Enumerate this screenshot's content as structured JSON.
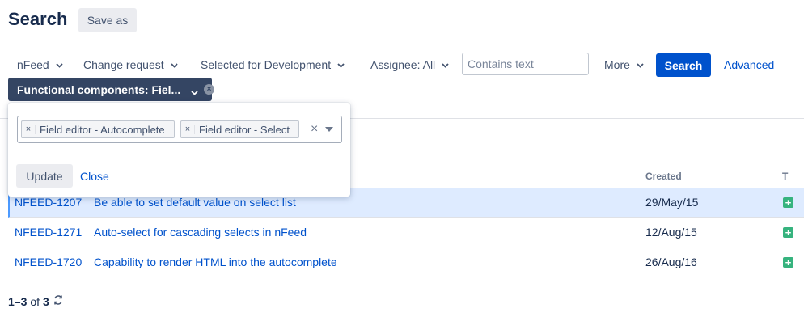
{
  "header": {
    "title": "Search",
    "save_as_label": "Save as"
  },
  "filters": {
    "project": "nFeed",
    "type": "Change request",
    "status": "Selected for Development",
    "assignee": "Assignee: All",
    "text_placeholder": "Contains text",
    "more": "More",
    "search_button": "Search",
    "advanced_link": "Advanced",
    "active_chip": "Functional components: Fiel..."
  },
  "popup": {
    "tags": [
      "Field editor - Autocomplete",
      "Field editor - Select"
    ],
    "tag_remove": "×",
    "clear": "×",
    "update_button": "Update",
    "close_link": "Close"
  },
  "table": {
    "columns": {
      "created": "Created",
      "type": "T"
    },
    "rows": [
      {
        "key": "NFEED-1207",
        "summary": "Be able to set default value on select list",
        "created": "29/May/15",
        "type_icon": "new-feature-icon",
        "selected": true
      },
      {
        "key": "NFEED-1271",
        "summary": "Auto-select for cascading selects in nFeed",
        "created": "12/Aug/15",
        "type_icon": "new-feature-icon",
        "selected": false
      },
      {
        "key": "NFEED-1720",
        "summary": "Capability to render HTML into the autocomplete",
        "created": "26/Aug/16",
        "type_icon": "new-feature-icon",
        "selected": false
      }
    ]
  },
  "pagination": {
    "range": "1–3",
    "of": "of",
    "total": "3"
  },
  "colors": {
    "accent": "#0052cc",
    "chip_bg": "#344563",
    "selected_row": "#deebff",
    "feature_icon": "#36b37e"
  }
}
